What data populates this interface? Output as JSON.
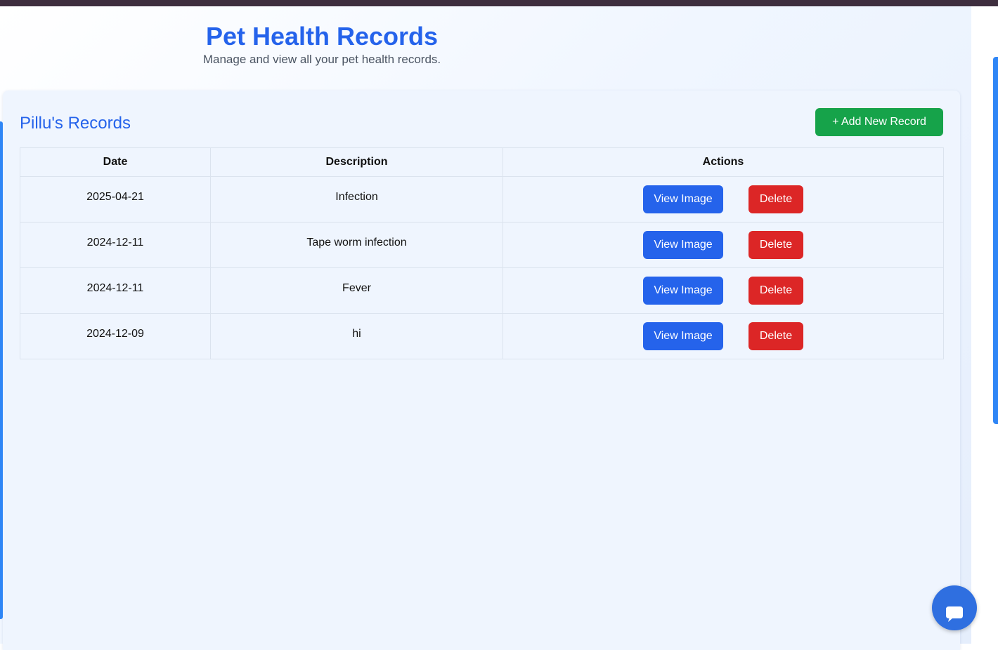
{
  "header": {
    "title": "Pet Health Records",
    "subtitle": "Manage and view all your pet health records."
  },
  "records_card": {
    "title": "Pillu's Records",
    "add_button_label": "+ Add New Record",
    "columns": [
      "Date",
      "Description",
      "Actions"
    ],
    "rows": [
      {
        "date": "2025-04-21",
        "description": "Infection",
        "view_label": "View Image",
        "delete_label": "Delete"
      },
      {
        "date": "2024-12-11",
        "description": "Tape worm infection",
        "view_label": "View Image",
        "delete_label": "Delete"
      },
      {
        "date": "2024-12-11",
        "description": "Fever",
        "view_label": "View Image",
        "delete_label": "Delete"
      },
      {
        "date": "2024-12-09",
        "description": "hi",
        "view_label": "View Image",
        "delete_label": "Delete"
      }
    ]
  },
  "chat": {
    "icon": "chat-bubble-icon"
  },
  "colors": {
    "primary": "#2563eb",
    "success": "#16a34a",
    "danger": "#dc2626",
    "chat_button": "#2f6fe0"
  }
}
